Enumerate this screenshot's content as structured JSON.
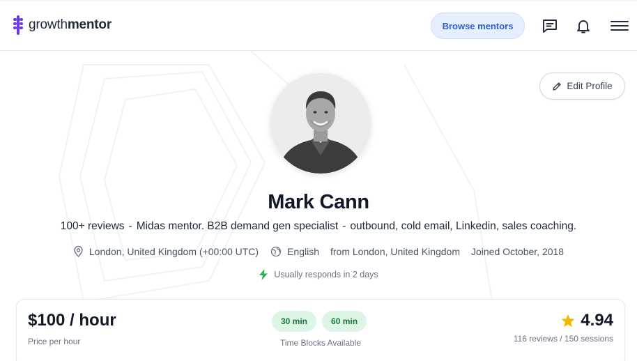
{
  "header": {
    "logo": {
      "text_light": "growth",
      "text_bold": "mentor",
      "icon": "growthmentor-logo-icon"
    },
    "browse_label": "Browse mentors",
    "icons": [
      "messages-icon",
      "bell-icon",
      "hamburger-menu-icon"
    ]
  },
  "profile": {
    "edit_label": "Edit Profile",
    "name": "Mark Cann",
    "headline_parts": [
      "100+ reviews",
      "Midas mentor. B2B demand gen specialist",
      "outbound, cold email, Linkedin, sales coaching."
    ],
    "separator": "-",
    "location": "London, United Kingdom (+00:00 UTC)",
    "language": "English",
    "origin": "from London, United Kingdom",
    "joined": "Joined October, 2018",
    "responds": "Usually responds in 2 days"
  },
  "pricing": {
    "price": "$100 / hour",
    "price_label": "Price per hour",
    "blocks": [
      "30 min",
      "60 min"
    ],
    "blocks_label": "Time Blocks Available",
    "rating": "4.94",
    "rating_sub": "116 reviews / 150 sessions"
  },
  "colors": {
    "accent": "#6d3ce0",
    "browse_bg": "#e6efff",
    "browse_text": "#2f5fd0",
    "pill_bg": "#dcf5e4",
    "pill_text": "#16783d",
    "bolt": "#2fae4e",
    "star": "#f5b800"
  }
}
